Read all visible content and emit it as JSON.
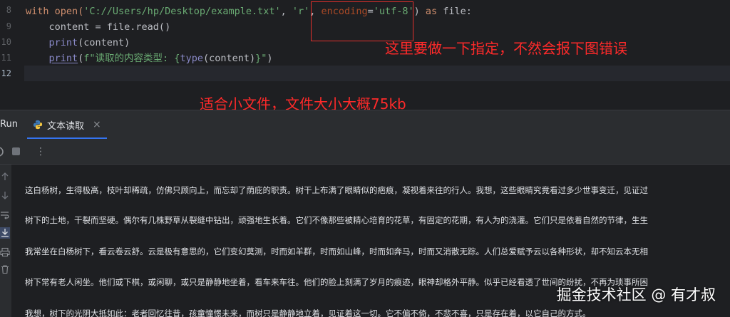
{
  "editor": {
    "line_numbers": [
      "8",
      "9",
      "10",
      "11",
      "12"
    ],
    "line8": {
      "p1": "with open(",
      "p2": "'C://Users/hp/Desktop/example.txt'",
      "p3": ", ",
      "p4": "'r'",
      "p5": ", ",
      "p6": "encoding",
      "p7": "=",
      "p8": "'utf-8'",
      "p9": ") ",
      "p10": "as",
      "p11": " file:"
    },
    "line9": "    content = file.read()",
    "line10": {
      "fn": "print",
      "rest": "(content)"
    },
    "line11": {
      "fn": "print",
      "p1": "(",
      "p2": "f\"读取的内容类型: {",
      "p3": "type",
      "p4": "(content)",
      "p5": "}\"",
      "p6": ")"
    }
  },
  "annotations": {
    "note1": "这里要做一下指定，不然会报下图错误",
    "note2": "适合小文件，文件大小大概75kb"
  },
  "run_panel": {
    "label": "Run",
    "tab_title": "文本读取",
    "tab_close": "×",
    "menu_glyph": "⋮"
  },
  "console": {
    "lines": [
      "这白杨树，生得极高，枝叶却稀疏，仿佛只顾向上，而忘却了荫庇的职责。树干上布满了眼睛似的疤痕，凝视着来往的行人。我想，这些眼睛究竟看过多少世事变迁，见证过",
      "树下的土地，干裂而坚硬。偶尔有几株野草从裂缝中钻出，顽强地生长着。它们不像那些被精心培育的花草，有固定的花期，有人为的浇灌。它们只是依着自然的节律，生生",
      "我常坐在白杨树下，看云卷云舒。云是极有意思的，它们变幻莫测，时而如羊群，时而如山峰，时而如奔马，时而又消散无踪。人们总爱赋予云以各种形状，却不知云本无相",
      "树下常有老人闲坐。他们或下棋，或闲聊，或只是静静地坐着，看车来车往。他们的脸上刻满了岁月的痕迹，眼神却格外平静。似乎已经看透了世间的纷扰，不再为琐事所困",
      "我想，树下的光阴大抵如此：老者回忆往昔，孩童憧憬未来，而树只是静静地立着，见证着这一切。它不偏不倚，不悲不喜，只是存在着，以它自己的方式。"
    ]
  },
  "watermark": "掘金技术社区 @ 有才叔",
  "colors": {
    "keyword": "#cf8e6d",
    "string": "#6aab73",
    "parameter": "#aa4926",
    "builtin": "#8888c6",
    "annotation_red": "#ff2a2a",
    "accent_blue": "#3574f0"
  },
  "icons": {
    "side": [
      "arrow-up-icon",
      "arrow-down-icon",
      "soft-wrap-icon",
      "scroll-to-end-icon",
      "print-icon",
      "trash-icon"
    ]
  }
}
